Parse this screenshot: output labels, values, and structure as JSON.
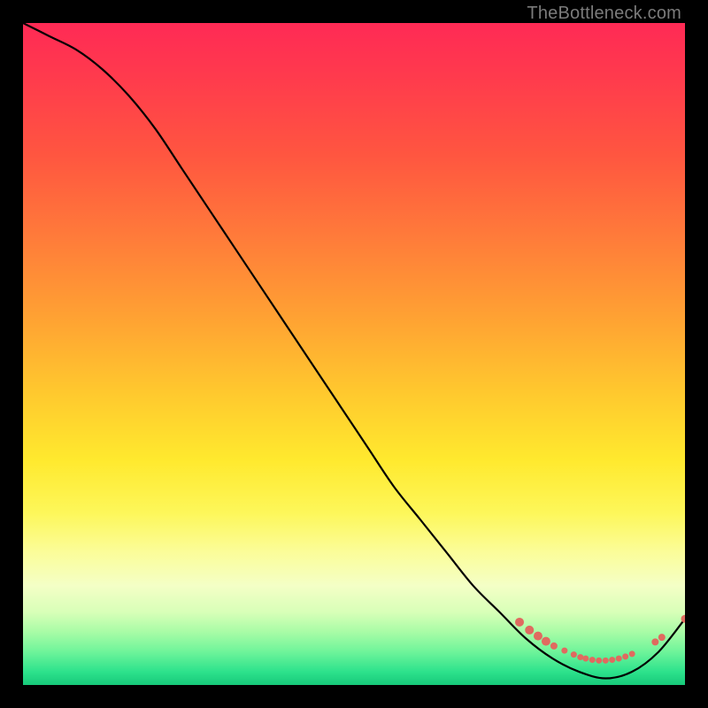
{
  "watermark": "TheBottleneck.com",
  "chart_data": {
    "type": "line",
    "title": "",
    "xlabel": "",
    "ylabel": "",
    "xlim": [
      0,
      100
    ],
    "ylim": [
      0,
      100
    ],
    "series": [
      {
        "name": "bottleneck-curve",
        "x": [
          0,
          4,
          8,
          12,
          16,
          20,
          24,
          28,
          32,
          36,
          40,
          44,
          48,
          52,
          56,
          60,
          64,
          68,
          72,
          76,
          80,
          84,
          88,
          92,
          96,
          100
        ],
        "y": [
          100,
          98,
          96,
          93,
          89,
          84,
          78,
          72,
          66,
          60,
          54,
          48,
          42,
          36,
          30,
          25,
          20,
          15,
          11,
          7,
          4,
          2,
          1,
          2,
          5,
          10
        ]
      }
    ],
    "markers": {
      "name": "highlight-dots",
      "color": "#e06a5f",
      "points": [
        {
          "x": 75,
          "y": 9.5,
          "r": 5
        },
        {
          "x": 76.5,
          "y": 8.3,
          "r": 5
        },
        {
          "x": 77.8,
          "y": 7.4,
          "r": 5
        },
        {
          "x": 79,
          "y": 6.6,
          "r": 5
        },
        {
          "x": 80.2,
          "y": 5.9,
          "r": 4
        },
        {
          "x": 81.8,
          "y": 5.2,
          "r": 3.5
        },
        {
          "x": 83.2,
          "y": 4.6,
          "r": 3.5
        },
        {
          "x": 84.2,
          "y": 4.2,
          "r": 3.5
        },
        {
          "x": 85.0,
          "y": 4.0,
          "r": 3.5
        },
        {
          "x": 86.0,
          "y": 3.8,
          "r": 3.5
        },
        {
          "x": 87.0,
          "y": 3.7,
          "r": 3.5
        },
        {
          "x": 88.0,
          "y": 3.7,
          "r": 3.5
        },
        {
          "x": 89.0,
          "y": 3.8,
          "r": 3.5
        },
        {
          "x": 90.0,
          "y": 4.0,
          "r": 3.5
        },
        {
          "x": 91.0,
          "y": 4.3,
          "r": 3.5
        },
        {
          "x": 92.0,
          "y": 4.7,
          "r": 3.5
        },
        {
          "x": 95.5,
          "y": 6.5,
          "r": 4
        },
        {
          "x": 96.5,
          "y": 7.2,
          "r": 4
        },
        {
          "x": 100,
          "y": 10,
          "r": 4.5
        }
      ]
    },
    "background_gradient": {
      "orientation": "vertical",
      "stops": [
        {
          "pos": 0.0,
          "color": "#ff2a55"
        },
        {
          "pos": 0.32,
          "color": "#ff7a3a"
        },
        {
          "pos": 0.66,
          "color": "#ffe92e"
        },
        {
          "pos": 0.85,
          "color": "#f4ffc6"
        },
        {
          "pos": 1.0,
          "color": "#17c97a"
        }
      ]
    }
  }
}
